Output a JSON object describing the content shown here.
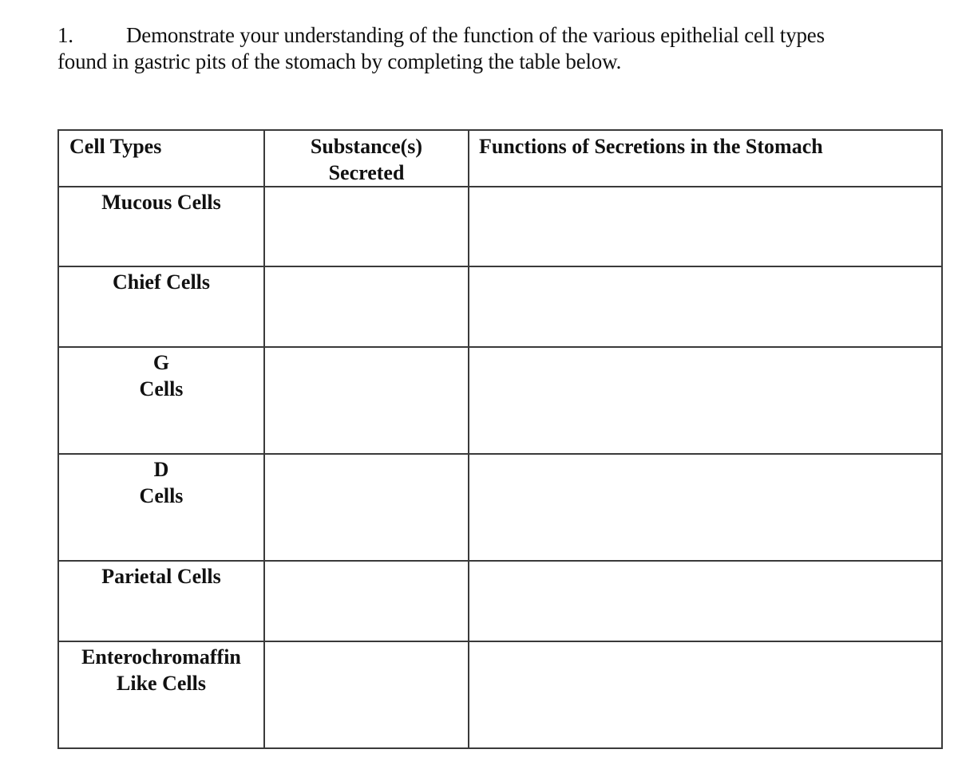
{
  "question": {
    "number": "1.",
    "text_line1": "Demonstrate your understanding of the function of the various epithelial cell types",
    "text_line2": "found in gastric pits of the stomach by completing the table below."
  },
  "table": {
    "headers": [
      "Cell Types",
      "Substance(s) Secreted",
      "Functions of Secretions in the Stomach"
    ],
    "rows": [
      {
        "cell_type_line1": "Mucous Cells",
        "cell_type_line2": "",
        "substances": "",
        "functions": ""
      },
      {
        "cell_type_line1": "Chief Cells",
        "cell_type_line2": "",
        "substances": "",
        "functions": ""
      },
      {
        "cell_type_line1": "G",
        "cell_type_line2": "Cells",
        "substances": "",
        "functions": ""
      },
      {
        "cell_type_line1": "D",
        "cell_type_line2": "Cells",
        "substances": "",
        "functions": ""
      },
      {
        "cell_type_line1": "Parietal Cells",
        "cell_type_line2": "",
        "substances": "",
        "functions": ""
      },
      {
        "cell_type_line1": "Enterochromaffin",
        "cell_type_line2": "Like Cells",
        "substances": "",
        "functions": ""
      }
    ]
  }
}
